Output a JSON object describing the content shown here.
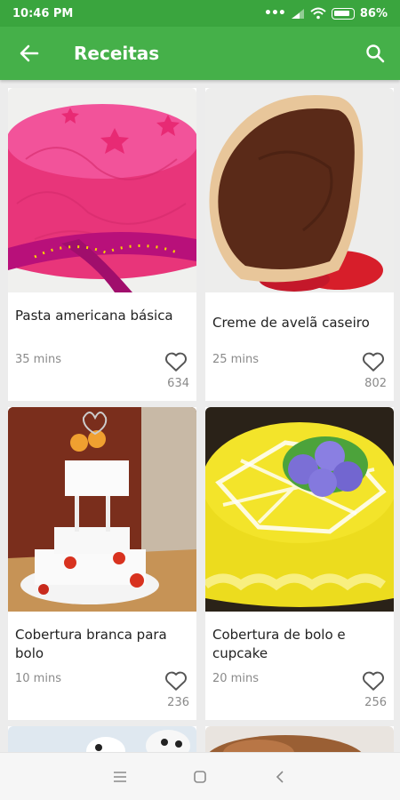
{
  "status_bar": {
    "time": "10:46 PM",
    "battery": "86%"
  },
  "app_bar": {
    "title": "Receitas"
  },
  "recipes": [
    {
      "name": "Pasta americana básica",
      "time": "35 mins",
      "likes": "634",
      "image": "pink-fondant-cake"
    },
    {
      "name": "Creme de avelã caseiro",
      "time": "25 mins",
      "likes": "802",
      "image": "hazelnut-spread-bread"
    },
    {
      "name": "Cobertura branca para bolo",
      "time": "10 mins",
      "likes": "236",
      "image": "white-wedding-cake"
    },
    {
      "name": "Cobertura de bolo e cupcake",
      "time": "20 mins",
      "likes": "256",
      "image": "yellow-frosted-cake"
    }
  ],
  "icons": {
    "back": "arrow-left-icon",
    "search": "search-icon",
    "like": "heart-outline-icon",
    "nav_menu": "menu-icon",
    "nav_home": "square-home-icon",
    "nav_back": "chevron-left-icon"
  },
  "colors": {
    "primary": "#45b049",
    "status": "#3aa53e"
  }
}
